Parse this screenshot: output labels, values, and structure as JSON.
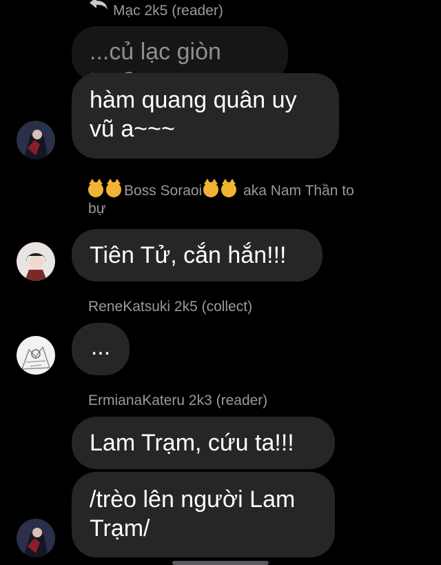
{
  "messages": [
    {
      "sender": "Mạc 2k5 (reader)",
      "quoted_text": "...củ lạc giòn tan?",
      "text_lines": [
        "hàm quang quân uy",
        "vũ a~~~"
      ]
    },
    {
      "sender_line1": "Boss Soraoi",
      "sender_suffix": "aka Nam Thần to",
      "sender_line2": "bự",
      "text": "Tiên Tử, cắn hắn!!!"
    },
    {
      "sender": "ReneKatsuki 2k5 (collect)",
      "text": "..."
    },
    {
      "sender": "ErmianaKateru 2k3 (reader)",
      "texts": [
        "Lam Trạm, cứu ta!!!"
      ],
      "multiline_lines": [
        "/trèo lên người Lam",
        "Trạm/"
      ]
    }
  ],
  "colors": {
    "background": "#000000",
    "bubble": "#262628",
    "quoted_bubble": "#161617",
    "sender_text": "#9a9a9f"
  },
  "icons": {
    "reply": "reply-arrow-icon",
    "emoji": "cat-face-emoji"
  }
}
